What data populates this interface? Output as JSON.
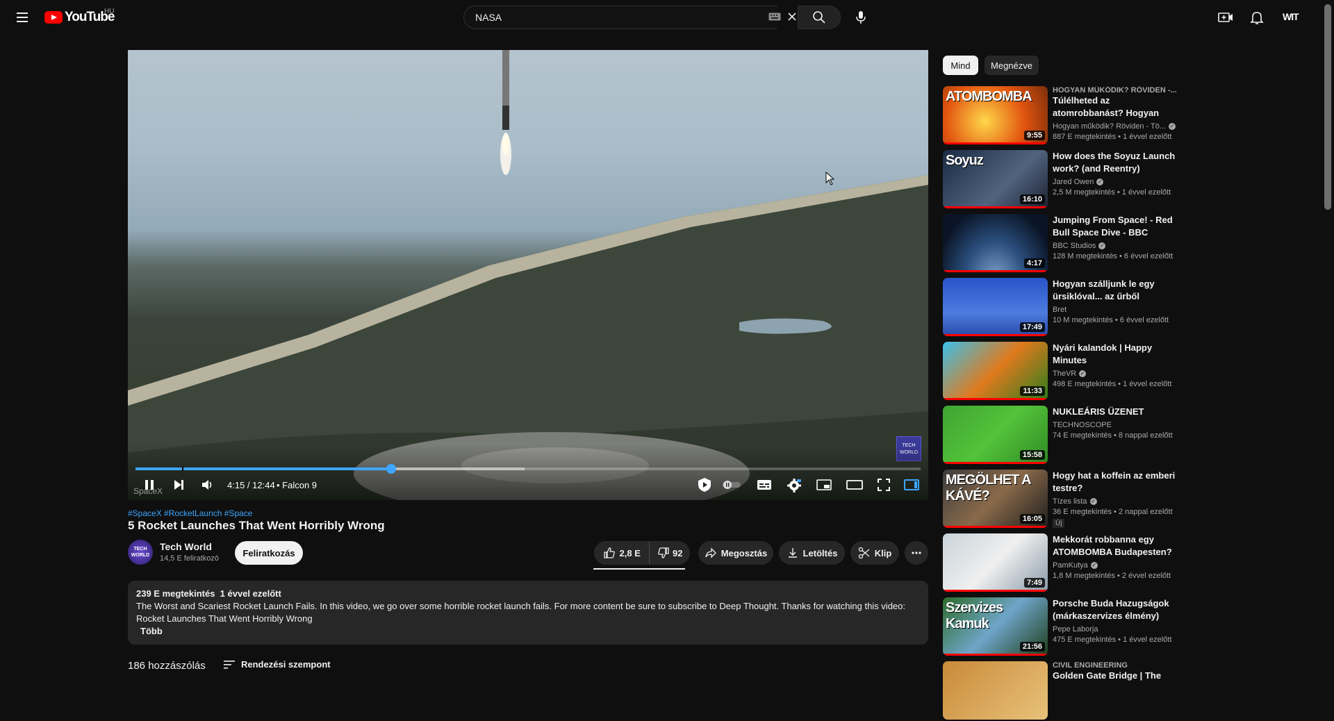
{
  "header": {
    "logo_text": "YouTube",
    "country_code": "HU",
    "search_value": "NASA",
    "account_label": "WIT"
  },
  "player": {
    "time_current": "4:15",
    "time_total": "12:44",
    "time_display": "4:15 / 12:44",
    "chapter": "• Falcon 9",
    "progress_fraction": 0.326,
    "buffered_fraction": 0.496,
    "watermark_text": "TECH WORLD",
    "ghost_text": "SpaceX"
  },
  "video": {
    "hashtags": "#SpaceX #RocketLaunch #Space",
    "title": "5 Rocket Launches That Went Horribly Wrong",
    "channel_name": "Tech World",
    "subscribers": "14,5 E feliratkozó",
    "avatar_text": "TECH WORLD",
    "subscribe_label": "Feliratkozás",
    "likes": "2,8 E",
    "dislikes": "92",
    "share_label": "Megosztás",
    "download_label": "Letöltés",
    "clip_label": "Klip"
  },
  "description": {
    "meta": "239 E megtekintés  1 évvel ezelőtt",
    "text": "The Worst and Scariest Rocket Launch Fails. In this video, we go over some horrible rocket launch fails. For more content be sure to subscribe to Deep Thought. Thanks for watching this video: Rocket Launches That Went Horribly Wrong",
    "more_label": "Több"
  },
  "comments": {
    "count_label": "186 hozzászólás",
    "sort_label": "Rendezési szempont"
  },
  "sidebar": {
    "chips": [
      "Mind",
      "Megnézve"
    ],
    "recommendations": [
      {
        "series": "HOGYAN MŰKÖDIK? RÖVIDEN -...",
        "title": "Túlélheted az atomrobbanást? Hogyan működik az...",
        "channel": "Hogyan működik? Röviden - Tö...",
        "verified": true,
        "stats": "887 E megtekintés • 1 évvel ezelőtt",
        "duration": "9:55",
        "thumb_text": "ATOMBOMBA",
        "watched": 1.0
      },
      {
        "series": "",
        "title": "How does the Soyuz Launch work? (and Reentry)",
        "channel": "Jared Owen",
        "verified": true,
        "stats": "2,5 M megtekintés • 1 évvel ezelőtt",
        "duration": "16:10",
        "thumb_text": "Soyuz",
        "watched": 1.0
      },
      {
        "series": "",
        "title": "Jumping From Space! - Red Bull Space Dive - BBC",
        "channel": "BBC Studios",
        "verified": true,
        "stats": "128 M megtekintés • 6 évvel ezelőtt",
        "duration": "4:17",
        "thumb_text": "",
        "watched": 1.0
      },
      {
        "series": "",
        "title": "Hogyan szálljunk le egy ürsiklóval... az űrből",
        "channel": "Bret",
        "verified": false,
        "stats": "10 M megtekintés • 6 évvel ezelőtt",
        "duration": "17:49",
        "thumb_text": "",
        "watched": 1.0
      },
      {
        "series": "",
        "title": "Nyári kalandok | Happy Minutes",
        "channel": "TheVR",
        "verified": true,
        "stats": "498 E megtekintés • 1 évvel ezelőtt",
        "duration": "11:33",
        "thumb_text": "",
        "watched": 1.0
      },
      {
        "series": "",
        "title": "NUKLEÁRIS ÜZENET",
        "channel": "TECHNOSCOPE",
        "verified": false,
        "stats": "74 E megtekintés • 8 nappal ezelőtt",
        "duration": "15:58",
        "thumb_text": "",
        "watched": 1.0
      },
      {
        "series": "",
        "title": "Hogy hat a koffein az emberi testre?",
        "channel": "Tízes lista",
        "verified": true,
        "stats": "36 E megtekintés • 2 nappal ezelőtt",
        "duration": "16:05",
        "thumb_text": "MEGÖLHET A KÁVÉ?",
        "new_badge": "Új",
        "watched": 1.0
      },
      {
        "series": "",
        "title": "Mekkorát robbanna egy ATOMBOMBA Budapesten?",
        "channel": "PamKutya",
        "verified": true,
        "stats": "1,8 M megtekintés • 2 évvel ezelőtt",
        "duration": "7:49",
        "thumb_text": "",
        "watched": 1.0
      },
      {
        "series": "",
        "title": "Porsche Buda Hazugságok (márkaszervizes élmény)",
        "channel": "Pepe Laborja",
        "verified": false,
        "stats": "475 E megtekintés • 1 évvel ezelőtt",
        "duration": "21:56",
        "thumb_text": "Szervizes Kamuk",
        "watched": 1.0
      },
      {
        "series": "CIVIL ENGINEERING",
        "title": "Golden Gate Bridge | The",
        "channel": "",
        "verified": false,
        "stats": "",
        "duration": "",
        "thumb_text": "",
        "watched": 0
      }
    ]
  },
  "colors": {
    "background": "#0f0f0f",
    "accent_blue": "#3ea6ff",
    "brand_red": "#ff0000",
    "pill_bg": "#272727"
  },
  "icons": [
    "menu-icon",
    "keyboard-icon",
    "clear-icon",
    "search-icon",
    "mic-icon",
    "create-icon",
    "bell-icon",
    "pause-icon",
    "next-icon",
    "volume-icon",
    "autoplay-icon",
    "subtitles-icon",
    "settings-icon",
    "miniplayer-icon",
    "theater-icon",
    "fullscreen-icon",
    "like-icon",
    "dislike-icon",
    "share-icon",
    "download-icon",
    "clip-icon",
    "more-icon",
    "sort-icon"
  ]
}
